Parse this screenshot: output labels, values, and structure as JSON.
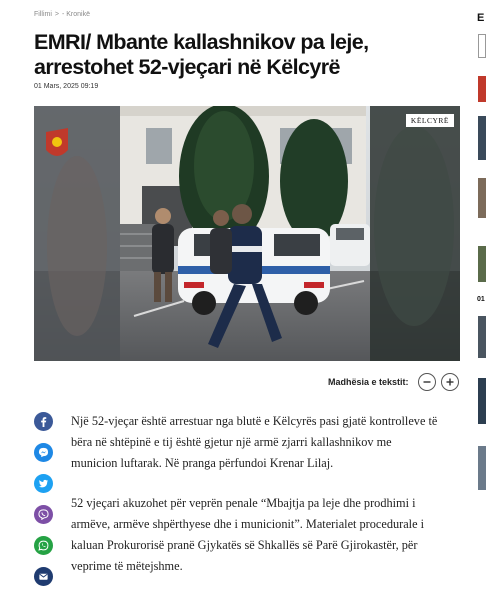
{
  "breadcrumb": {
    "home": "Fillimi",
    "separator": ">",
    "section": "- Kronikë"
  },
  "article": {
    "title": "EMRI/ Mbante kallashnikov pa leje, arrestohet 52-vjeçari në Këlcyrë",
    "date": "01 Mars, 2025 09:19",
    "image_location_badge": "KËLCYRË",
    "paragraphs": [
      "Një 52-vjeçar është arrestuar nga blutë e Këlcyrës pasi gjatë kontrolleve të bëra në shtëpinë e tij është gjetur një armë zjarri kallashnikov me municion luftarak. Në pranga përfundoi Krenar Lilaj.",
      "52 vjeçari akuzohet për veprën penale “Mbajtja pa leje dhe prodhimi i armëve, armëve shpërthyese dhe i municionit”. Materialet procedurale i kaluan Prokurorisë pranë Gjykatës së Shkallës së Parë Gjirokastër, për veprime të mëtejshme."
    ]
  },
  "text_size": {
    "label": "Madhësia e tekstit:",
    "decrease": "minus-icon",
    "increase": "plus-icon"
  },
  "share_buttons": [
    {
      "icon": "facebook-icon",
      "color": "#3b5998"
    },
    {
      "icon": "messenger-icon",
      "color": "#1e88e5"
    },
    {
      "icon": "twitter-icon",
      "color": "#1da1f2"
    },
    {
      "icon": "viber-icon",
      "color": "#7d4fa6"
    },
    {
      "icon": "whatsapp-icon",
      "color": "#25a244"
    },
    {
      "icon": "email-icon",
      "color": "#1f3b70"
    }
  ],
  "right_rail": {
    "header_letter": "E",
    "snippet": "01"
  }
}
